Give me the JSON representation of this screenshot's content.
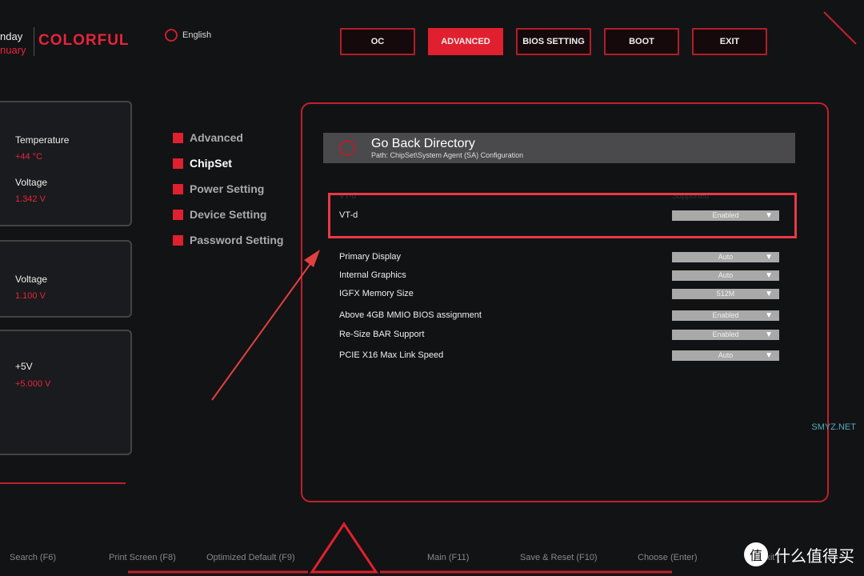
{
  "brand": {
    "line1": "nday",
    "line2": "nuary",
    "logo": "COLORFUL"
  },
  "language": {
    "icon": "globe-icon",
    "label": "English"
  },
  "nav": [
    {
      "label": "OC"
    },
    {
      "label": "ADVANCED",
      "active": true
    },
    {
      "label": "BIOS SETTING"
    },
    {
      "label": "BOOT"
    },
    {
      "label": "EXIT"
    }
  ],
  "monitor": [
    {
      "label": "Temperature",
      "value": "+44 °C"
    },
    {
      "label": "Voltage",
      "value": "1.342 V"
    },
    {
      "label": "Voltage",
      "value": "1.100 V"
    },
    {
      "label": "+5V",
      "value": "+5.000 V"
    }
  ],
  "menu": [
    {
      "label": "Advanced"
    },
    {
      "label": "ChipSet",
      "selected": true
    },
    {
      "label": "Power Setting"
    },
    {
      "label": "Device Setting"
    },
    {
      "label": "Password Setting"
    }
  ],
  "goback": {
    "title": "Go Back Directory",
    "path": "Path: ChipSet\\System Agent (SA) Configuration"
  },
  "vtd_header": {
    "label": "VT-d",
    "status": "Supported"
  },
  "settings": [
    {
      "label": "VT-d",
      "value": "Enabled"
    },
    {
      "label": "Primary Display",
      "value": "Auto"
    },
    {
      "label": "Internal Graphics",
      "value": "Auto"
    },
    {
      "label": "IGFX Memory Size",
      "value": "512M"
    },
    {
      "label": "Above 4GB MMIO BIOS assignment",
      "value": "Enabled"
    },
    {
      "label": "Re-Size BAR Support",
      "value": "Enabled"
    },
    {
      "label": "PCIE X16 Max Link Speed",
      "value": "Auto"
    }
  ],
  "footer": [
    "Search (F6)",
    "Print Screen (F8)",
    "Optimized Default (F9)",
    "Main (F11)",
    "Save & Reset (F10)",
    "Choose (Enter)",
    "Exit ("
  ],
  "watermark": {
    "glyph": "值",
    "text": "什么值得买",
    "site": "SMYZ.NET"
  },
  "colors": {
    "accent": "#e0202e",
    "background": "#121315"
  }
}
